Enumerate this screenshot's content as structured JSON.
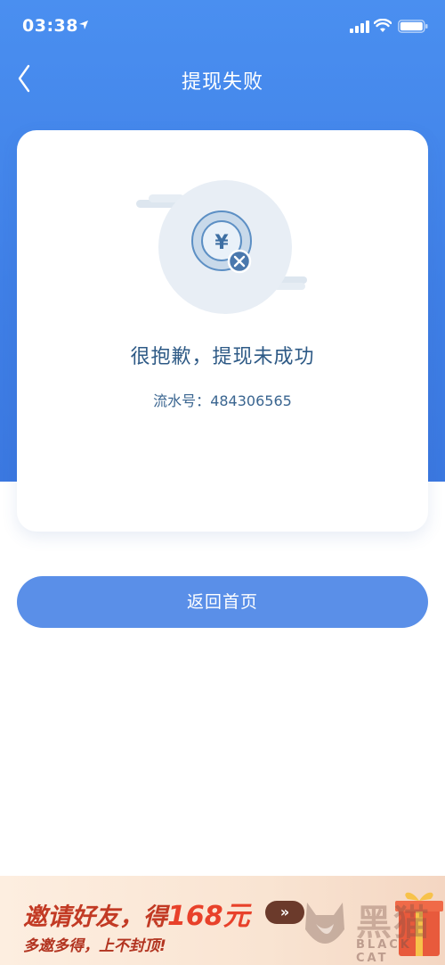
{
  "status_bar": {
    "time": "03:38"
  },
  "nav": {
    "title": "提现失败"
  },
  "result": {
    "message": "很抱歉，提现未成功",
    "serial_label": "流水号：",
    "serial_number": "484306565",
    "currency_symbol": "¥"
  },
  "actions": {
    "home_button_label": "返回首页"
  },
  "banner": {
    "title_prefix": "邀请好友，得",
    "title_amount": "168元",
    "arrow": "»",
    "subtitle": "多邀多得，上不封顶!"
  },
  "watermark": {
    "cn": "黑猫",
    "en": "BLACK CAT"
  },
  "colors": {
    "primary_blue": "#3f7fe6",
    "button_blue": "#5a8fe8",
    "text_dark_blue": "#2e5a86",
    "banner_red": "#c23a24"
  }
}
